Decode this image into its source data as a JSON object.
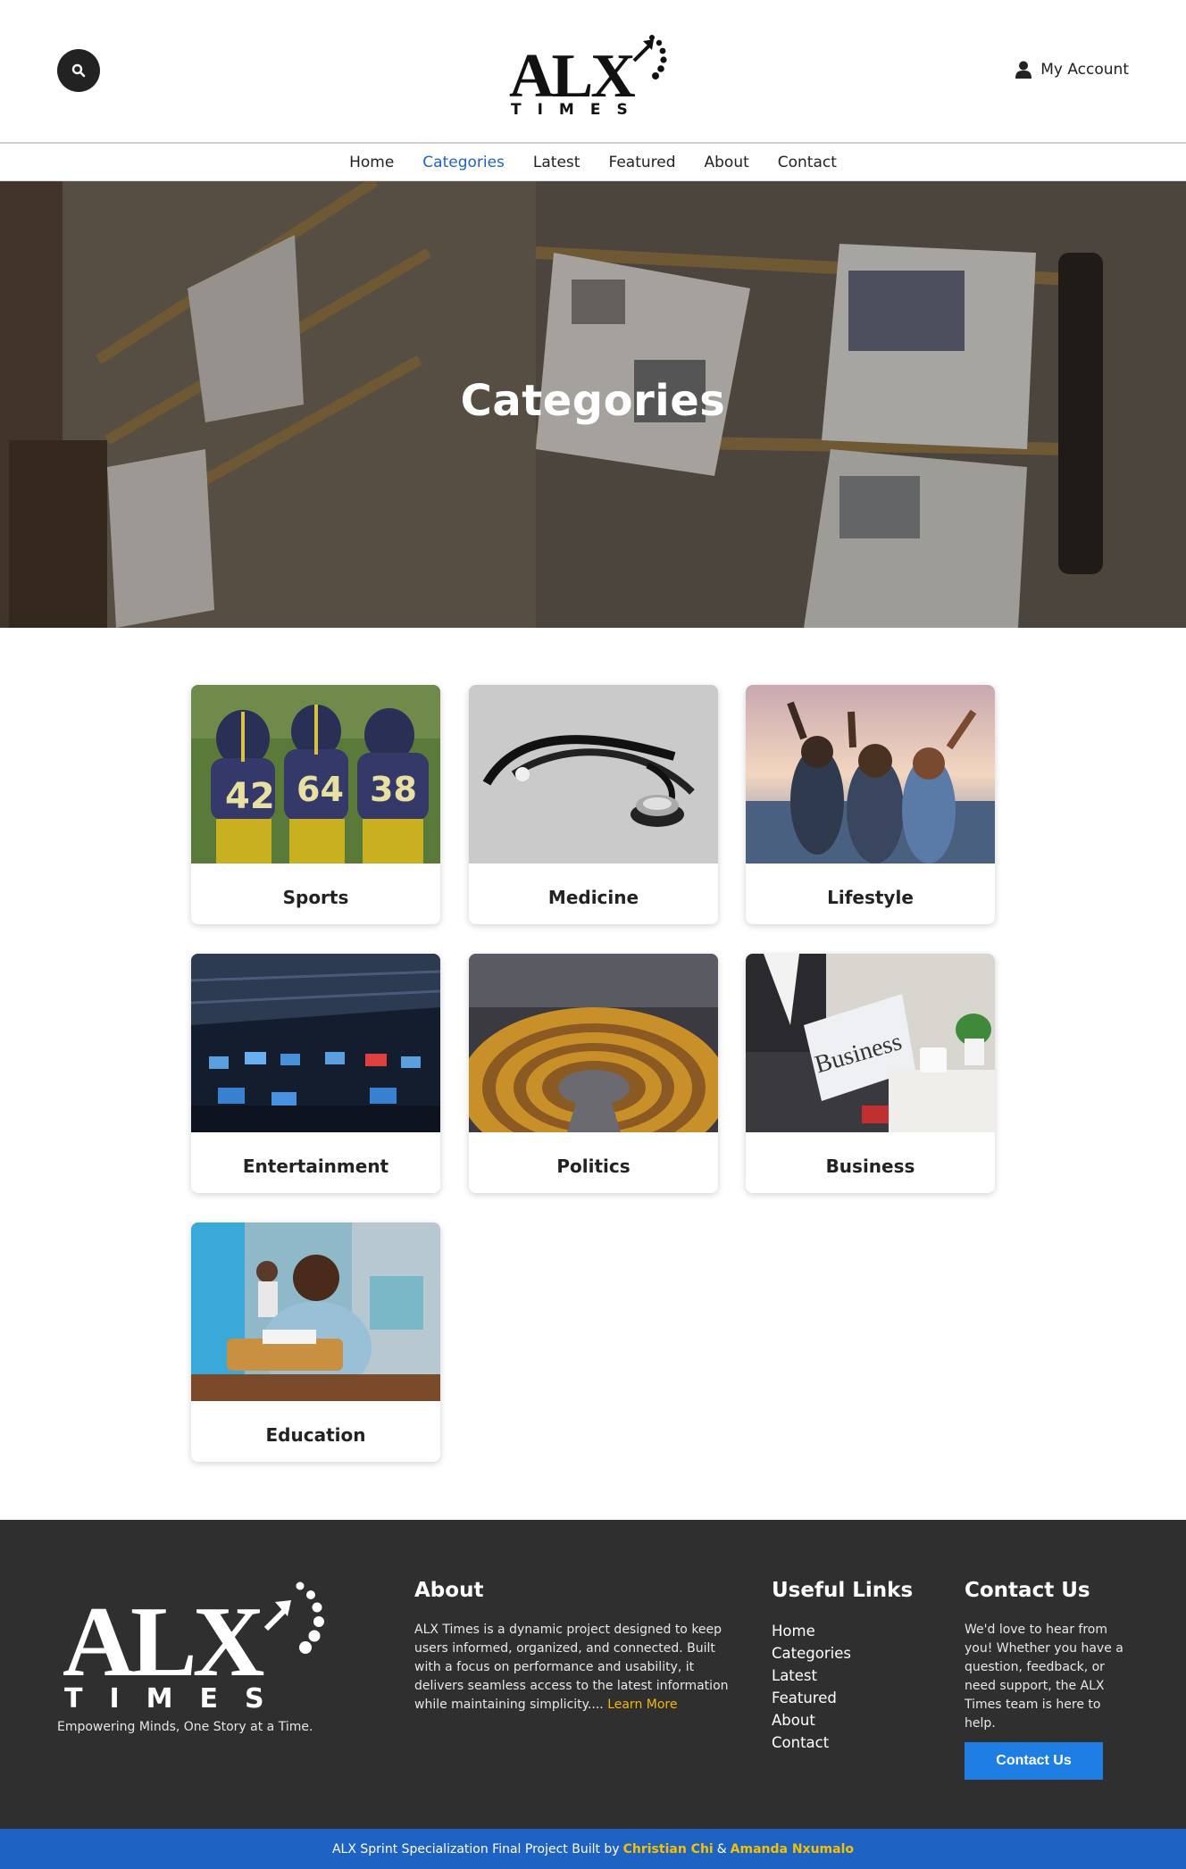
{
  "header": {
    "logo_main": "ALX",
    "logo_sub": "TIMES",
    "account_label": "My Account"
  },
  "nav": {
    "items": [
      "Home",
      "Categories",
      "Latest",
      "Featured",
      "About",
      "Contact"
    ],
    "active": "Categories"
  },
  "hero": {
    "title": "Categories"
  },
  "categories": [
    {
      "label": "Sports",
      "icon": "football-players-image"
    },
    {
      "label": "Medicine",
      "icon": "stethoscope-image"
    },
    {
      "label": "Lifestyle",
      "icon": "friends-sunset-image"
    },
    {
      "label": "Entertainment",
      "icon": "gaming-arena-image"
    },
    {
      "label": "Politics",
      "icon": "parliament-chamber-image"
    },
    {
      "label": "Business",
      "icon": "business-newspaper-image"
    },
    {
      "label": "Education",
      "icon": "student-classroom-image"
    }
  ],
  "footer": {
    "logo_main": "ALX",
    "logo_sub": "TIMES",
    "tagline": "Empowering Minds, One Story at a Time.",
    "about_title": "About",
    "about_text": "ALX Times is a dynamic project designed to keep users informed, organized, and connected. Built with a focus on performance and usability, it delivers seamless access to the latest information while maintaining simplicity....",
    "learn_more": "Learn More",
    "links_title": "Useful Links",
    "links": [
      "Home",
      "Categories",
      "Latest",
      "Featured",
      "About",
      "Contact"
    ],
    "contact_title": "Contact Us",
    "contact_text": "We'd love to hear from you! Whether you have a question, feedback, or need support, the ALX Times team is here to help.",
    "contact_button": "Contact Us"
  },
  "bottom_bar": {
    "prefix": "ALX Sprint Specialization Final Project Built by",
    "author1": "Christian Chi",
    "joiner": "&",
    "author2": "Amanda Nxumalo"
  },
  "colors": {
    "accent_blue": "#1e63c4",
    "button_blue": "#1e7ee4",
    "highlight_yellow": "#f5b800",
    "footer_bg": "#2f2f2f"
  }
}
